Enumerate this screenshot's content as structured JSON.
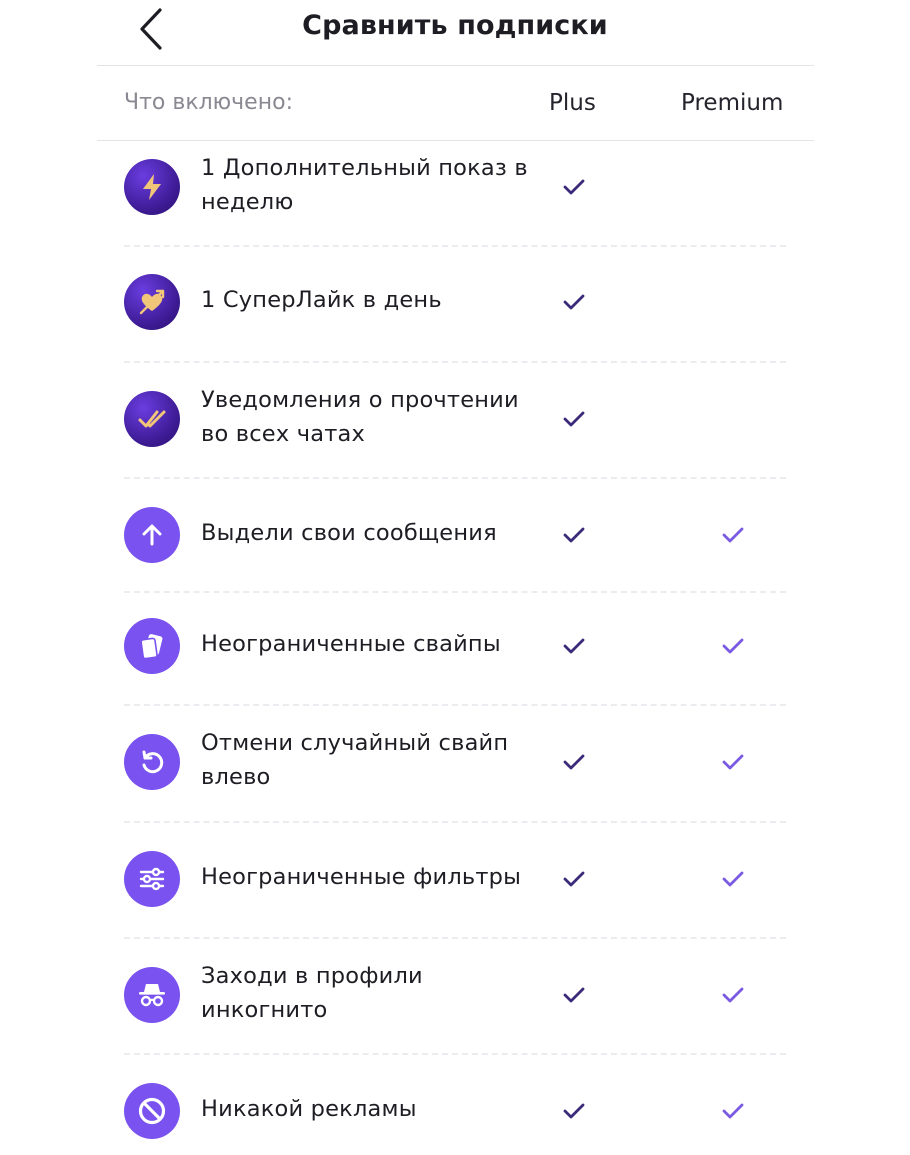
{
  "header": {
    "back_icon": "chevron-left-icon",
    "title": "Сравнить подписки"
  },
  "columns": {
    "label": "Что включено:",
    "plus": "Plus",
    "premium": "Premium"
  },
  "colors": {
    "plus_check": "#3b2a7a",
    "premium_check": "#7b5ae3",
    "icon_dark": "#3d1b94",
    "icon_bright": "#7a52f0",
    "icon_gold": "#f2c679"
  },
  "features": [
    {
      "label": "1 Дополнительный показ в неделю",
      "icon": "lightning-icon",
      "plus": true,
      "premium": false
    },
    {
      "label": "1 СуперЛайк в день",
      "icon": "heart-arrow-icon",
      "plus": true,
      "premium": false
    },
    {
      "label": "Уведомления о прочтении во всех чатах",
      "icon": "double-check-icon",
      "plus": true,
      "premium": false
    },
    {
      "label": "Выдели свои сообщения",
      "icon": "arrow-up-icon",
      "plus": true,
      "premium": true
    },
    {
      "label": "Неограниченные свайпы",
      "icon": "cards-icon",
      "plus": true,
      "premium": true
    },
    {
      "label": "Отмени случайный свайп влево",
      "icon": "undo-icon",
      "plus": true,
      "premium": true
    },
    {
      "label": "Неограниченные фильтры",
      "icon": "sliders-icon",
      "plus": true,
      "premium": true
    },
    {
      "label": "Заходи в профили инкогнито",
      "icon": "incognito-icon",
      "plus": true,
      "premium": true
    },
    {
      "label": "Никакой рекламы",
      "icon": "no-ads-icon",
      "plus": true,
      "premium": true
    }
  ]
}
